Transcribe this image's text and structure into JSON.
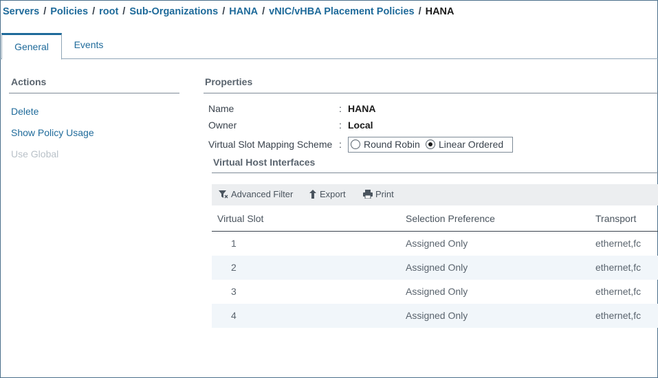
{
  "breadcrumb": {
    "items": [
      "Servers",
      "Policies",
      "root",
      "Sub-Organizations",
      "HANA",
      "vNIC/vHBA Placement Policies"
    ],
    "current": "HANA",
    "separator": "/"
  },
  "tabs": [
    {
      "label": "General",
      "active": true
    },
    {
      "label": "Events",
      "active": false
    }
  ],
  "actions": {
    "title": "Actions",
    "items": [
      {
        "label": "Delete",
        "enabled": true
      },
      {
        "label": "Show Policy Usage",
        "enabled": true
      },
      {
        "label": "Use Global",
        "enabled": false
      }
    ]
  },
  "properties": {
    "title": "Properties",
    "name_label": "Name",
    "name_value": "HANA",
    "owner_label": "Owner",
    "owner_value": "Local",
    "scheme_label": "Virtual Slot Mapping Scheme",
    "colon": ":",
    "scheme_options": [
      {
        "label": "Round Robin",
        "selected": false
      },
      {
        "label": "Linear Ordered",
        "selected": true
      }
    ]
  },
  "vhi": {
    "title": "Virtual Host Interfaces",
    "toolbar": {
      "filter": "Advanced Filter",
      "export": "Export",
      "print": "Print"
    },
    "columns": [
      "Virtual Slot",
      "Selection Preference",
      "Transport"
    ],
    "rows": [
      {
        "slot": "1",
        "preference": "Assigned Only",
        "transport": "ethernet,fc"
      },
      {
        "slot": "2",
        "preference": "Assigned Only",
        "transport": "ethernet,fc"
      },
      {
        "slot": "3",
        "preference": "Assigned Only",
        "transport": "ethernet,fc"
      },
      {
        "slot": "4",
        "preference": "Assigned Only",
        "transport": "ethernet,fc"
      }
    ]
  },
  "colors": {
    "link": "#1e6a9a",
    "border": "#4a6f8a",
    "alt_row": "#f1f6fa",
    "toolbar_bg": "#eceef0",
    "disabled": "#b9c1c8"
  }
}
